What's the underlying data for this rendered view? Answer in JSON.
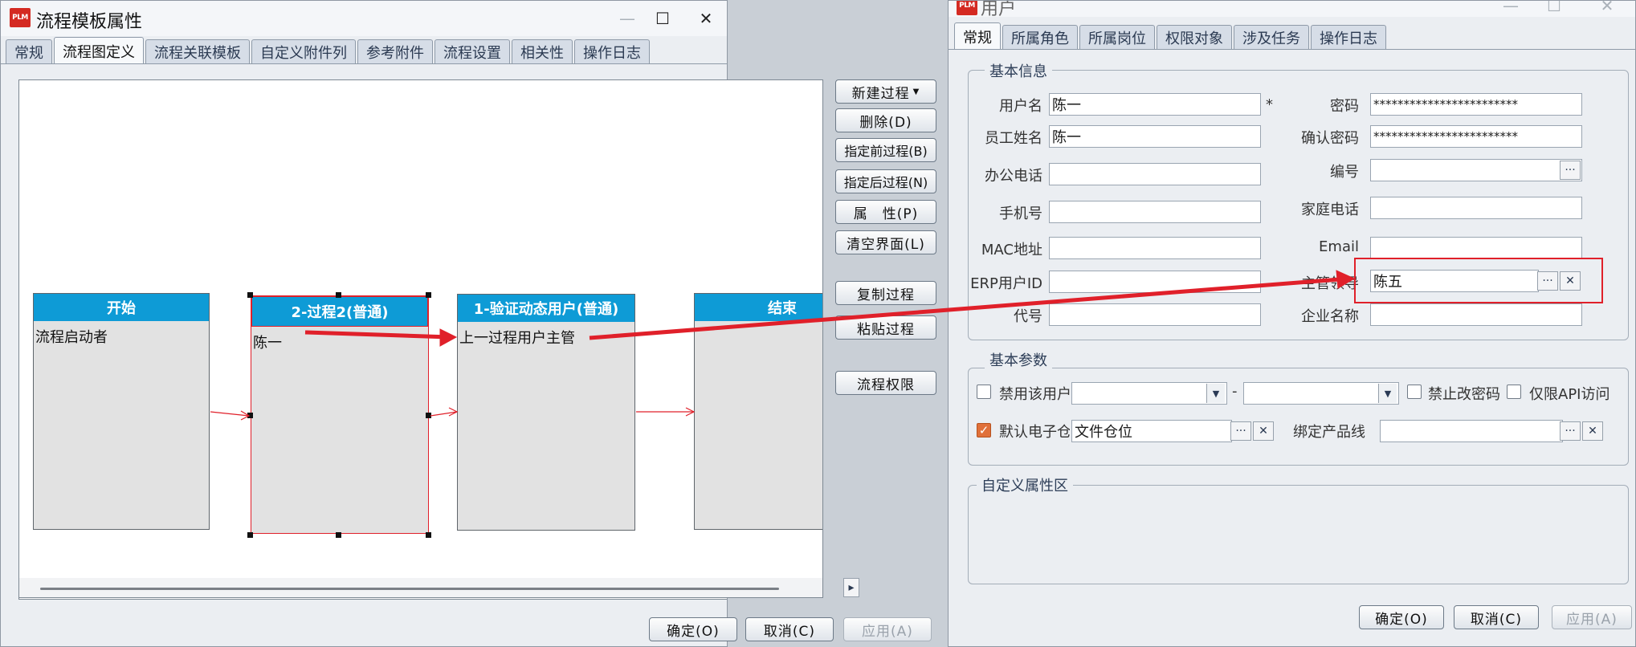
{
  "left_window": {
    "title": "流程模板属性",
    "logo": "PLM",
    "tabs": [
      "常规",
      "流程图定义",
      "流程关联模板",
      "自定义附件列",
      "参考附件",
      "流程设置",
      "相关性",
      "操作日志"
    ],
    "active_tab": "流程图定义",
    "nodes": [
      {
        "title": "开始",
        "body": "流程启动者"
      },
      {
        "title": "2-过程2(普通)",
        "body": "陈一"
      },
      {
        "title": "1-验证动态用户(普通)",
        "body": "上一过程用户主管"
      },
      {
        "title": "结束",
        "body": ""
      }
    ],
    "side_buttons": {
      "new": "新建过程",
      "delete": "删除(D)",
      "set_prev": "指定前过程(B)",
      "set_next": "指定后过程(N)",
      "props": "属　性(P)",
      "clear": "清空界面(L)",
      "copy": "复制过程",
      "paste": "粘贴过程",
      "perm": "流程权限"
    },
    "footer": {
      "ok": "确定(O)",
      "cancel": "取消(C)",
      "apply": "应用(A)"
    }
  },
  "right_window": {
    "title": "用户",
    "logo": "PLM",
    "tabs": [
      "常规",
      "所属角色",
      "所属岗位",
      "权限对象",
      "涉及任务",
      "操作日志"
    ],
    "active_tab": "常规",
    "basic_info": {
      "legend": "基本信息",
      "username_label": "用户名",
      "username": "陈一",
      "required_mark": "*",
      "password_label": "密码",
      "password": "************************",
      "fullname_label": "员工姓名",
      "fullname": "陈一",
      "confirm_label": "确认密码",
      "confirm": "************************",
      "office_phone_label": "办公电话",
      "office_phone": "",
      "number_label": "编号",
      "number": "",
      "mobile_label": "手机号",
      "mobile": "",
      "home_phone_label": "家庭电话",
      "home_phone": "",
      "mac_label": "MAC地址",
      "mac": "",
      "email_label": "Email",
      "email": "",
      "erp_label": "ERP用户ID",
      "erp": "",
      "manager_label": "主管领导",
      "manager": "陈五",
      "code_label": "代号",
      "code": "",
      "company_label": "企业名称",
      "company": ""
    },
    "basic_params": {
      "legend": "基本参数",
      "disable_user": "禁用该用户",
      "date_separator": "-",
      "no_pwd_change": "禁止改密码",
      "api_only": "仅限API访问",
      "default_vault": "默认电子仓",
      "default_vault_value": "文件仓位",
      "default_vault_checked": true,
      "product_line_label": "绑定产品线",
      "product_line": ""
    },
    "custom": {
      "legend": "自定义属性区"
    },
    "footer": {
      "ok": "确定(O)",
      "cancel": "取消(C)",
      "apply": "应用(A)"
    }
  },
  "colors": {
    "node_header": "#0e9bd6",
    "annotation_red": "#e0202a",
    "checkbox_on": "#e0703a"
  }
}
